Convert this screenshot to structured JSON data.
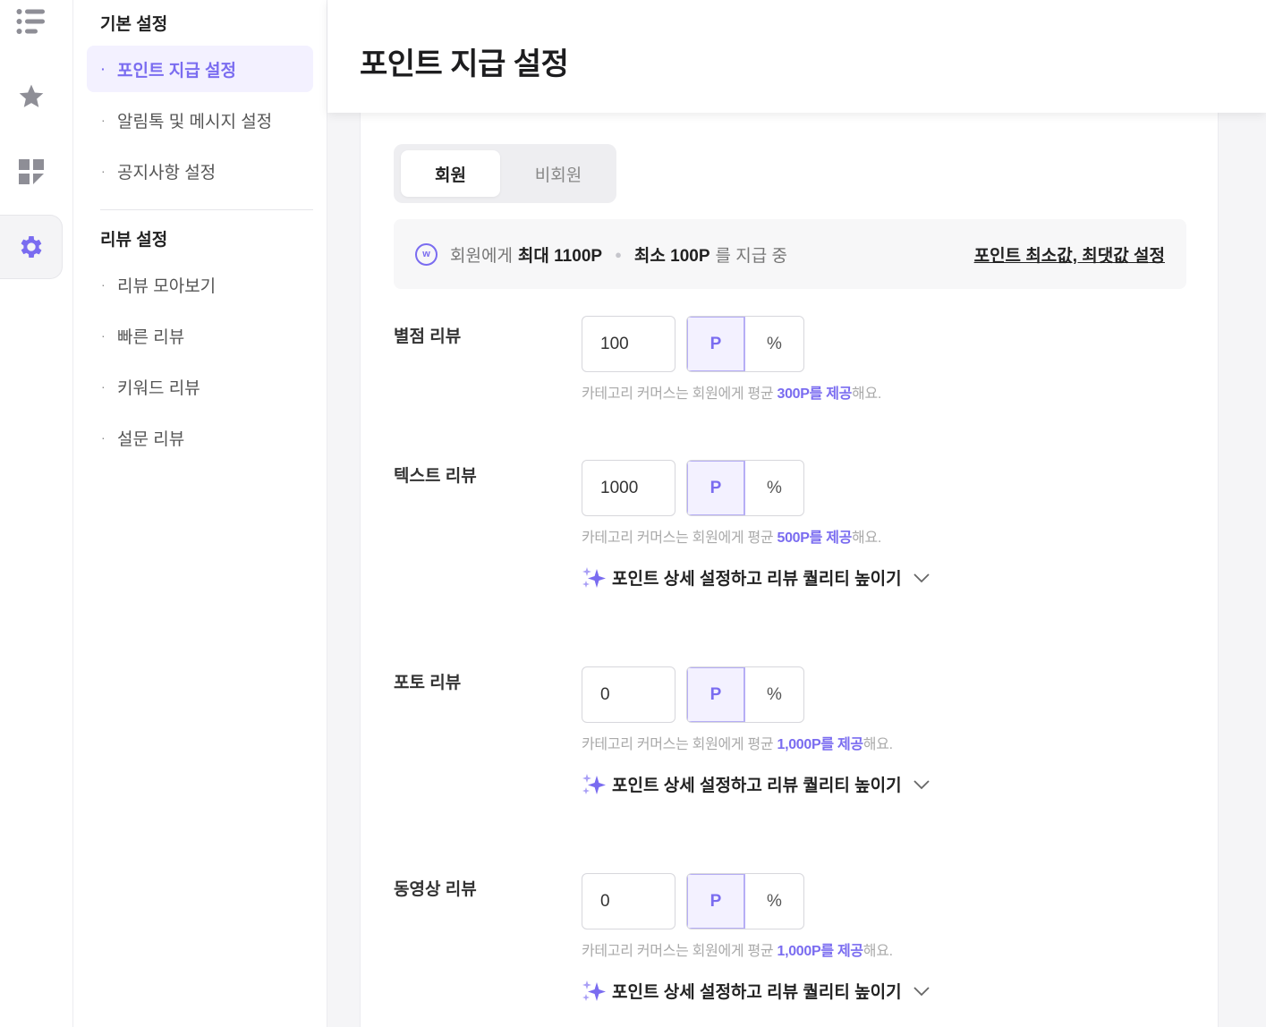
{
  "colors": {
    "accent": "#7a6cf0",
    "accent_bg": "#f3f1ff"
  },
  "rail": {
    "items": [
      {
        "icon": "list-icon",
        "active": false
      },
      {
        "icon": "star-icon",
        "active": false
      },
      {
        "icon": "dashboard-icon",
        "active": false
      },
      {
        "icon": "gear-icon",
        "active": true
      }
    ]
  },
  "subnav": {
    "section1_title": "기본 설정",
    "section1_items": [
      "포인트 지급 설정",
      "알림톡 및 메시지 설정",
      "공지사항 설정"
    ],
    "section2_title": "리뷰 설정",
    "section2_items": [
      "리뷰 모아보기",
      "빠른 리뷰",
      "키워드 리뷰",
      "설문 리뷰"
    ],
    "bullet": "·"
  },
  "header": {
    "title": "포인트 지급 설정"
  },
  "tabs": {
    "member": "회원",
    "non_member": "비회원"
  },
  "info": {
    "icon_letter": "w",
    "prefix": "회원에게",
    "max": "최대 1100P",
    "min": "최소 100P",
    "suffix": "를 지급 중",
    "link": "포인트 최소값, 최댓값 설정"
  },
  "units": {
    "point": "P",
    "percent": "%"
  },
  "hint": {
    "prefix": "카테고리 커머스는 회원에게 평균 ",
    "suffix": "해요."
  },
  "detail_label": "포인트 상세 설정하고 리뷰 퀄리티 높이기",
  "reviews": [
    {
      "label": "별점 리뷰",
      "value": "100",
      "highlight": "300P를 제공",
      "has_detail": false
    },
    {
      "label": "텍스트 리뷰",
      "value": "1000",
      "highlight": "500P를 제공",
      "has_detail": true
    },
    {
      "label": "포토 리뷰",
      "value": "0",
      "highlight": "1,000P를 제공",
      "has_detail": true
    },
    {
      "label": "동영상 리뷰",
      "value": "0",
      "highlight": "1,000P를 제공",
      "has_detail": true
    }
  ]
}
